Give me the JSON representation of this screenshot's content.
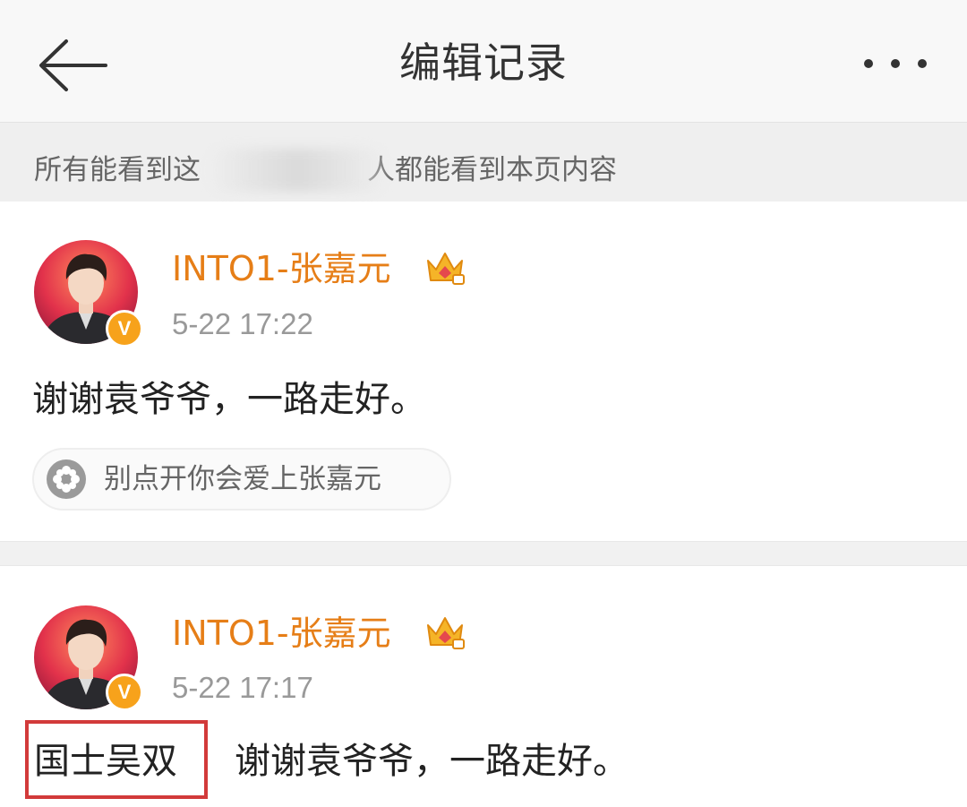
{
  "navbar": {
    "title": "编辑记录",
    "back_icon": "arrow-left-icon",
    "more_icon": "more-dots-icon"
  },
  "notice": {
    "text_before": "所有能看到这",
    "text_after": "人都能看到本页内容"
  },
  "records": [
    {
      "username": "INTO1-张嘉元",
      "timestamp": "5-22 17:22",
      "content": "谢谢袁爷爷，一路走好。",
      "verified_label": "V",
      "topic": "别点开你会爱上张嘉元"
    },
    {
      "username": "INTO1-张嘉元",
      "timestamp": "5-22 17:17",
      "verified_label": "V",
      "highlighted_text": "国士吴双",
      "content": "谢谢袁爷爷，一路走好。"
    }
  ],
  "colors": {
    "username": "#e67e17",
    "verify_badge": "#f7a21b",
    "highlight_border": "#d23a3a"
  }
}
